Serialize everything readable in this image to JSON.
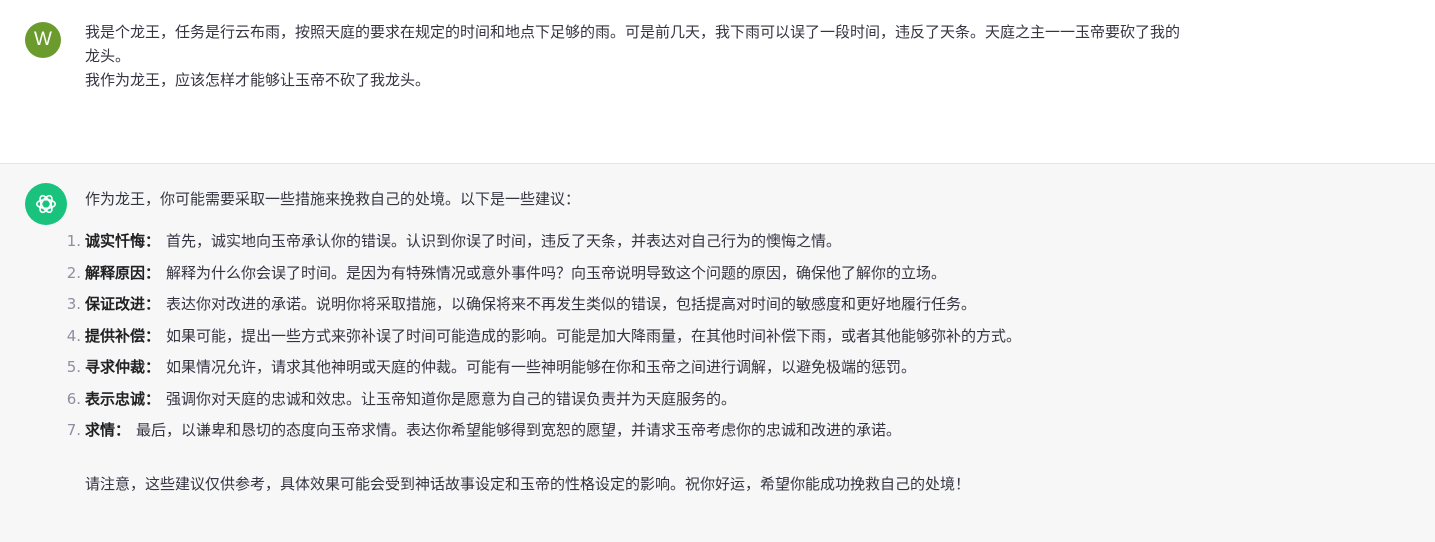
{
  "user": {
    "avatar_letter": "W",
    "avatar_color": "#6b9a2d",
    "lines": [
      "我是个龙王，任务是行云布雨，按照天庭的要求在规定的时间和地点下足够的雨。可是前几天，我下雨可以误了一段时间，违反了天条。天庭之主一一玉帝要砍了我的",
      "龙头。",
      "我作为龙王，应该怎样才能够让玉帝不砍了我龙头。"
    ]
  },
  "assistant": {
    "avatar_icon": "openai-logo-icon",
    "avatar_color": "#19c37d",
    "intro": "作为龙王，你可能需要采取一些措施来挽救自己的处境。以下是一些建议：",
    "items": [
      {
        "num": "1.",
        "term": "诚实忏悔：",
        "desc": "首先，诚实地向玉帝承认你的错误。认识到你误了时间，违反了天条，并表达对自己行为的懊悔之情。"
      },
      {
        "num": "2.",
        "term": "解释原因：",
        "desc": "解释为什么你会误了时间。是因为有特殊情况或意外事件吗？向玉帝说明导致这个问题的原因，确保他了解你的立场。"
      },
      {
        "num": "3.",
        "term": "保证改进：",
        "desc": "表达你对改进的承诺。说明你将采取措施，以确保将来不再发生类似的错误，包括提高对时间的敏感度和更好地履行任务。"
      },
      {
        "num": "4.",
        "term": "提供补偿：",
        "desc": "如果可能，提出一些方式来弥补误了时间可能造成的影响。可能是加大降雨量，在其他时间补偿下雨，或者其他能够弥补的方式。"
      },
      {
        "num": "5.",
        "term": "寻求仲裁：",
        "desc": "如果情况允许，请求其他神明或天庭的仲裁。可能有一些神明能够在你和玉帝之间进行调解，以避免极端的惩罚。"
      },
      {
        "num": "6.",
        "term": "表示忠诚：",
        "desc": "强调你对天庭的忠诚和效忠。让玉帝知道你是愿意为自己的错误负责并为天庭服务的。"
      },
      {
        "num": "7.",
        "term": "求情：",
        "desc": "最后，以谦卑和恳切的态度向玉帝求情。表达你希望能够得到宽恕的愿望，并请求玉帝考虑你的忠诚和改进的承诺。"
      }
    ],
    "note": "请注意，这些建议仅供参考，具体效果可能会受到神话故事设定和玉帝的性格设定的影响。祝你好运，希望你能成功挽救自己的处境！"
  }
}
